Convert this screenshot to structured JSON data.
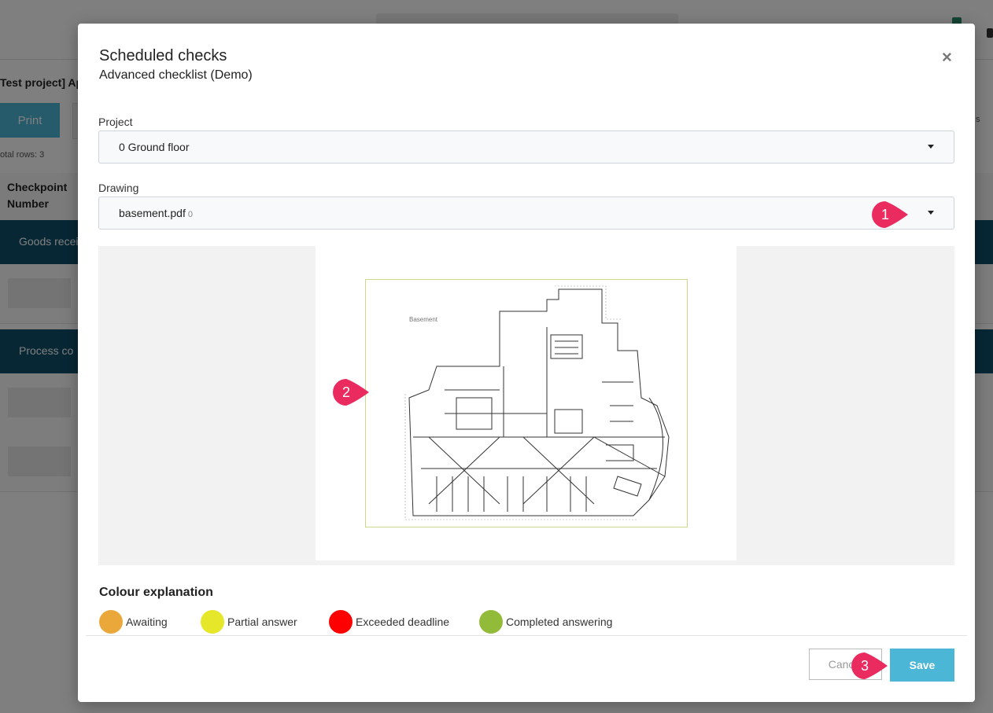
{
  "background": {
    "project_prefix": "Test project] Apa",
    "print_label": "Print",
    "total_rows": "otal rows: 3",
    "column_header": "Checkpoint Number",
    "column_header_line1": "Checkpoint",
    "column_header_line2": "Number",
    "section1": "Goods recei",
    "section2": "Process co",
    "filter_text": "s"
  },
  "modal": {
    "title": "Scheduled checks",
    "subtitle": "Advanced checklist (Demo)",
    "close_symbol": "×",
    "project_label": "Project",
    "project_value": "0 Ground floor",
    "drawing_label": "Drawing",
    "drawing_value": "basement.pdf",
    "drawing_count": "0",
    "drawing_sheet_label": "Basement",
    "colour_title": "Colour explanation",
    "legend": [
      {
        "label": "Awaiting",
        "color": "#eaa83a"
      },
      {
        "label": "Partial answer",
        "color": "#e6e62b"
      },
      {
        "label": "Exceeded deadline",
        "color": "#ff0000"
      },
      {
        "label": "Completed answering",
        "color": "#93bb3a"
      }
    ],
    "cancel_label": "Cancel",
    "save_label": "Save"
  },
  "annotations": {
    "badge1": "1",
    "badge2": "2",
    "badge3": "3",
    "badge_color": "#ea2b60"
  },
  "icons": {
    "close": "close-icon",
    "caret": "chevron-down-icon"
  }
}
